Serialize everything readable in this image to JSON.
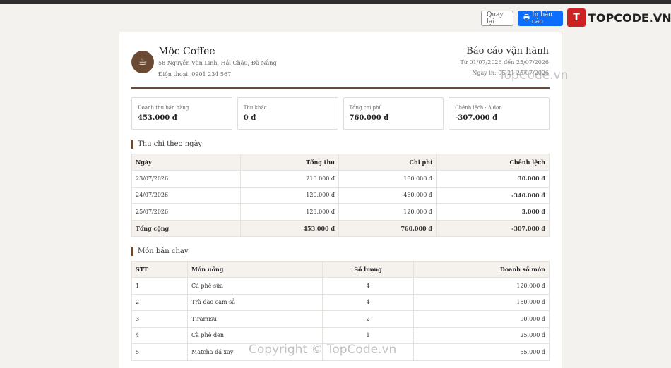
{
  "toolbar": {
    "back_label": "Quay lại",
    "print_label": "In báo cáo"
  },
  "brand": {
    "mark": "T",
    "text": "TOPCODE.VN"
  },
  "shop": {
    "name": "Mộc Coffee",
    "address": "58 Nguyễn Văn Linh, Hải Châu, Đà Nẵng",
    "phone": "Điện thoại: 0901 234 567"
  },
  "report": {
    "title": "Báo cáo vận hành",
    "range": "Từ 01/07/2026 đến 25/07/2026",
    "printed": "Ngày in: 05-21 25/07/2026"
  },
  "cards": [
    {
      "label": "Doanh thu bán hàng",
      "value": "453.000 đ"
    },
    {
      "label": "Thu khác",
      "value": "0 đ"
    },
    {
      "label": "Tổng chi phí",
      "value": "760.000 đ"
    },
    {
      "label": "Chênh lệch · 3 đơn",
      "value": "-307.000 đ"
    }
  ],
  "daily": {
    "title": "Thu chi theo ngày",
    "headers": [
      "Ngày",
      "Tổng thu",
      "Chi phí",
      "Chênh lệch"
    ],
    "rows": [
      [
        "23/07/2026",
        "210.000 đ",
        "180.000 đ",
        "30.000 đ"
      ],
      [
        "24/07/2026",
        "120.000 đ",
        "460.000 đ",
        "-340.000 đ"
      ],
      [
        "25/07/2026",
        "123.000 đ",
        "120.000 đ",
        "3.000 đ"
      ]
    ],
    "total": [
      "Tổng cộng",
      "453.000 đ",
      "760.000 đ",
      "-307.000 đ"
    ]
  },
  "top": {
    "title": "Món bán chạy",
    "headers": [
      "STT",
      "Món uống",
      "Số lượng",
      "Doanh số món"
    ],
    "rows": [
      [
        "1",
        "Cà phê sữa",
        "4",
        "120.000 đ"
      ],
      [
        "2",
        "Trà đào cam sả",
        "4",
        "180.000 đ"
      ],
      [
        "3",
        "Tiramisu",
        "2",
        "90.000 đ"
      ],
      [
        "4",
        "Cà phê đen",
        "1",
        "25.000 đ"
      ],
      [
        "5",
        "Matcha đá xay",
        "",
        "55.000 đ"
      ]
    ]
  },
  "watermarks": {
    "top": "TopCode.vn",
    "bottom": "Copyright © TopCode.vn"
  }
}
